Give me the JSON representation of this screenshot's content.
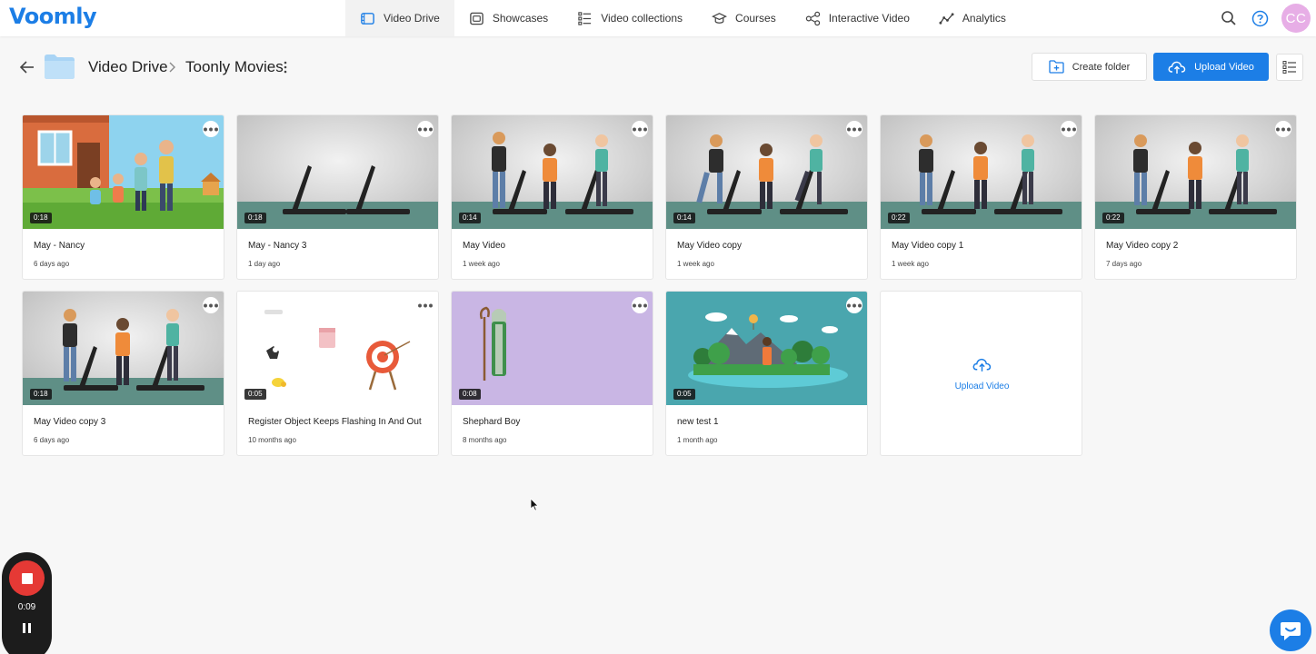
{
  "app": {
    "logo_text": "Voomly",
    "brand_color": "#1c7ee6"
  },
  "nav": {
    "items": [
      {
        "label": "Video Drive",
        "icon": "video-drive-icon",
        "active": true
      },
      {
        "label": "Showcases",
        "icon": "showcases-icon"
      },
      {
        "label": "Video collections",
        "icon": "collections-icon"
      },
      {
        "label": "Courses",
        "icon": "courses-icon"
      },
      {
        "label": "Interactive Video",
        "icon": "interactive-icon"
      },
      {
        "label": "Analytics",
        "icon": "analytics-icon"
      }
    ],
    "avatar_initials": "CC"
  },
  "header": {
    "breadcrumb_root": "Video Drive",
    "breadcrumb_current": "Toonly Movies",
    "create_folder_label": "Create folder",
    "upload_video_label": "Upload Video"
  },
  "videos": [
    {
      "title": "May - Nancy",
      "date": "6 days ago",
      "duration": "0:18"
    },
    {
      "title": "May - Nancy 3",
      "date": "1 day ago",
      "duration": "0:18"
    },
    {
      "title": "May Video",
      "date": "1 week ago",
      "duration": "0:14"
    },
    {
      "title": "May Video copy",
      "date": "1 week ago",
      "duration": "0:14"
    },
    {
      "title": "May Video copy 1",
      "date": "1 week ago",
      "duration": "0:22"
    },
    {
      "title": "May Video copy 2",
      "date": "7 days ago",
      "duration": "0:22"
    },
    {
      "title": "May Video copy 3",
      "date": "6 days ago",
      "duration": "0:18"
    },
    {
      "title": "Register Object Keeps Flashing In And Out",
      "date": "10 months ago",
      "duration": "0:05"
    },
    {
      "title": "Shephard Boy",
      "date": "8 months ago",
      "duration": "0:08"
    },
    {
      "title": "new test 1",
      "date": "1 month ago",
      "duration": "0:05"
    }
  ],
  "upload_card": {
    "label": "Upload Video"
  },
  "recorder": {
    "time": "0:09"
  }
}
